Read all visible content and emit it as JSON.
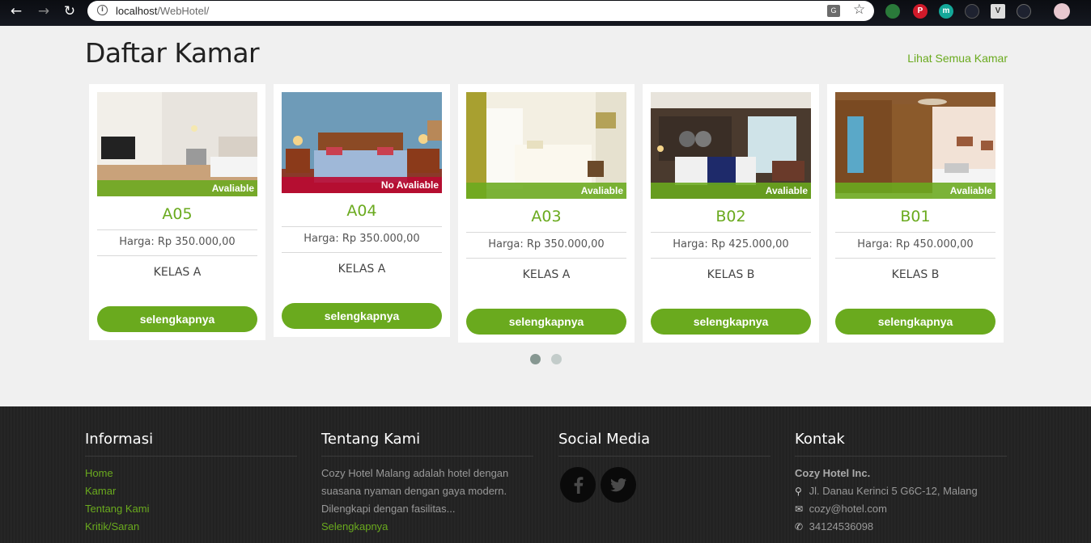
{
  "browser": {
    "url_host": "localhost",
    "url_path": "/WebHotel/",
    "back_icon": "arrow-left-icon",
    "forward_icon": "arrow-right-icon",
    "reload_icon": "reload-icon",
    "star_icon": "star-icon"
  },
  "section": {
    "title": "Daftar Kamar",
    "see_all": "Lihat Semua Kamar"
  },
  "rooms": [
    {
      "code": "A05",
      "status": "Avaliable",
      "price": "Harga: Rp 350.000,00",
      "class": "KELAS A",
      "button": "selengkapnya"
    },
    {
      "code": "A04",
      "status": "No Avaliable",
      "price": "Harga: Rp 350.000,00",
      "class": "KELAS A",
      "button": "selengkapnya"
    },
    {
      "code": "A03",
      "status": "Avaliable",
      "price": "Harga: Rp 350.000,00",
      "class": "KELAS A",
      "button": "selengkapnya"
    },
    {
      "code": "B02",
      "status": "Avaliable",
      "price": "Harga: Rp 425.000,00",
      "class": "KELAS B",
      "button": "selengkapnya"
    },
    {
      "code": "B01",
      "status": "Avaliable",
      "price": "Harga: Rp 450.000,00",
      "class": "KELAS B",
      "button": "selengkapnya"
    }
  ],
  "carousel": {
    "pages": 2,
    "active": 1
  },
  "footer": {
    "informasi": {
      "title": "Informasi",
      "links": [
        "Home",
        "Kamar",
        "Tentang Kami",
        "Kritik/Saran"
      ]
    },
    "tentang": {
      "title": "Tentang Kami",
      "lines": [
        "Cozy Hotel Malang adalah hotel dengan",
        "suasana nyaman dengan gaya modern.",
        "Dilengkapi dengan fasilitas..."
      ],
      "link": "Selengkapnya"
    },
    "social": {
      "title": "Social Media",
      "icons": [
        "facebook-icon",
        "twitter-icon"
      ]
    },
    "kontak": {
      "title": "Kontak",
      "company": "Cozy Hotel Inc.",
      "address": "Jl. Danau Kerinci 5 G6C-12, Malang",
      "email": "cozy@hotel.com",
      "phone": "34124536098"
    }
  },
  "colors": {
    "accent": "#6aaa1e",
    "unavailable": "#b90a32",
    "footer_bg": "#232323"
  }
}
